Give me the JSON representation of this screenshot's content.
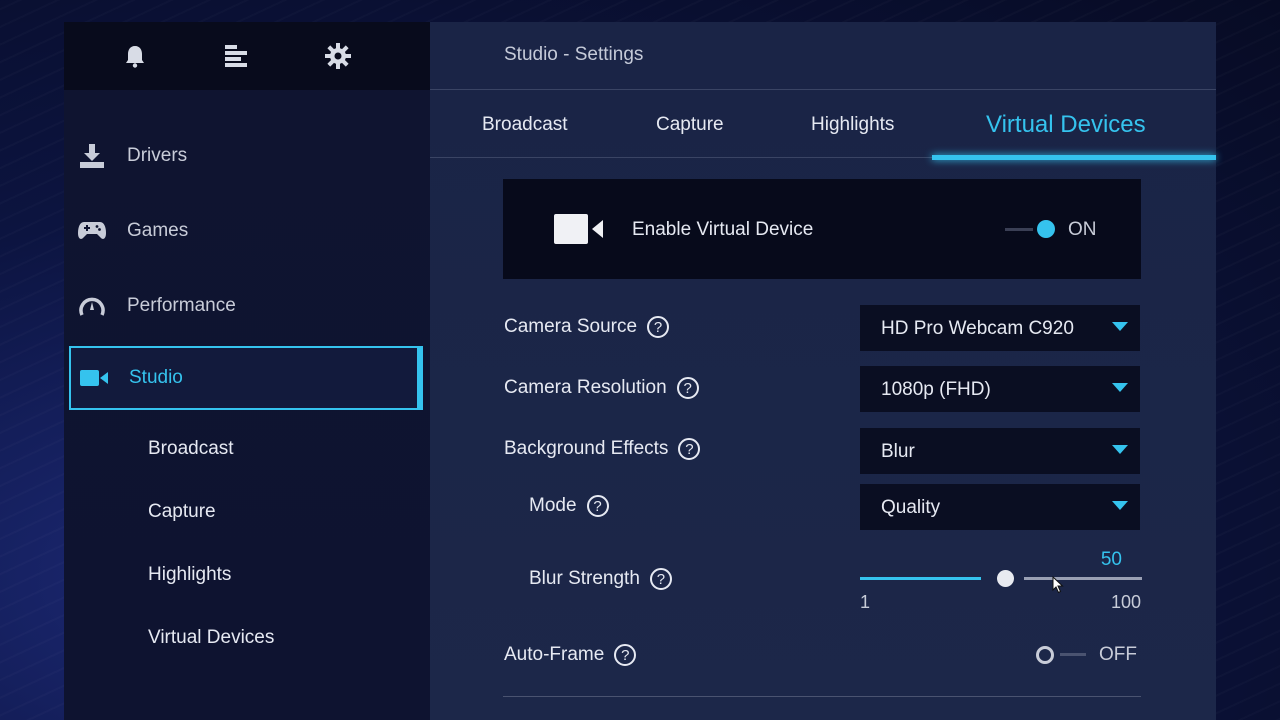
{
  "topbar": {
    "icons": [
      "bell-icon",
      "menu-icon",
      "gear-icon"
    ]
  },
  "sidebar": {
    "items": [
      {
        "label": "Drivers",
        "icon": "download-icon"
      },
      {
        "label": "Games",
        "icon": "gamepad-icon"
      },
      {
        "label": "Performance",
        "icon": "gauge-icon"
      },
      {
        "label": "Studio",
        "icon": "video-camera-icon",
        "active": true
      }
    ],
    "subitems": [
      {
        "label": "Broadcast"
      },
      {
        "label": "Capture"
      },
      {
        "label": "Highlights"
      },
      {
        "label": "Virtual Devices"
      }
    ]
  },
  "main": {
    "title": "Studio - Settings",
    "tabs": [
      {
        "label": "Broadcast"
      },
      {
        "label": "Capture"
      },
      {
        "label": "Highlights"
      },
      {
        "label": "Virtual Devices",
        "active": true
      }
    ],
    "enable": {
      "label": "Enable Virtual Device",
      "state": "ON",
      "on": true
    },
    "settings": {
      "camera_source": {
        "label": "Camera Source",
        "value": "HD Pro Webcam C920"
      },
      "camera_resolution": {
        "label": "Camera Resolution",
        "value": "1080p (FHD)"
      },
      "background_effects": {
        "label": "Background Effects",
        "value": "Blur"
      },
      "mode": {
        "label": "Mode",
        "value": "Quality"
      },
      "blur_strength": {
        "label": "Blur Strength",
        "value": "50",
        "min": "1",
        "max": "100",
        "fraction": 0.5
      },
      "auto_frame": {
        "label": "Auto-Frame",
        "state": "OFF",
        "on": false
      }
    },
    "help_glyph": "?"
  },
  "colors": {
    "accent": "#35c3ee",
    "panel_dark": "#0f1430",
    "panel_main": "#1a2446",
    "control_bg": "#0a0e22"
  }
}
